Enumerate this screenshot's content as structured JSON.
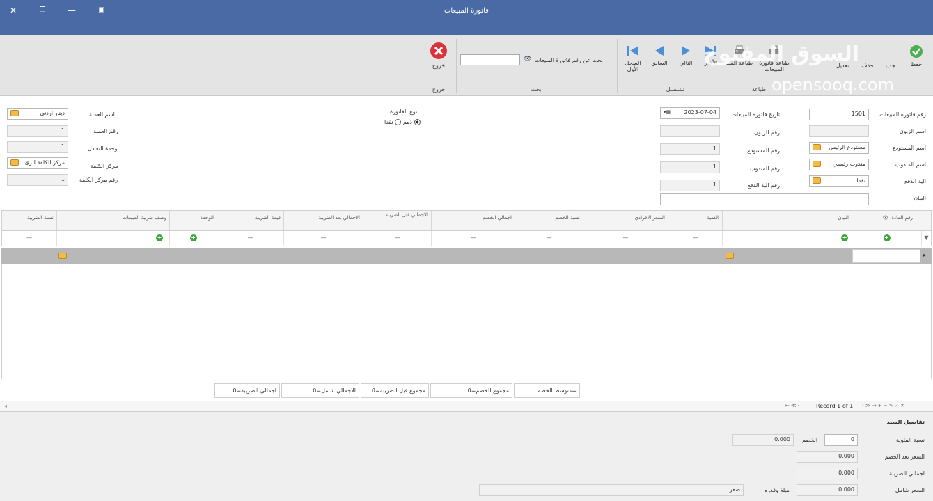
{
  "window": {
    "title": "فاتورة المبيعات",
    "close_label": "✕",
    "restore_label": "❐",
    "minimize_label": "—",
    "pin_label": "▣"
  },
  "ribbon": {
    "save": "حفظ",
    "new": "جديد",
    "delete": "حذف",
    "edit": "تعديل",
    "print_invoice": "طباعة فاتورة المبيعات",
    "print_entry": "طباعة القيد",
    "last": "الأخير",
    "next": "التالي",
    "previous": "السابق",
    "first": "السجل الأول",
    "group_print": "طباعة",
    "group_nav": "تـنــقــل",
    "search_label": "بحث عن رقم فاتورة المبيعات",
    "search_value": "",
    "group_search": "بحث",
    "exit": "خروج",
    "group_exit": "خروج"
  },
  "watermark": {
    "arabic": "السوق المفتوح",
    "latin": "opensooq.com"
  },
  "form": {
    "invoice_no_label": "رقم فاتورة المبيعات",
    "invoice_no": "1501",
    "customer_label": "اسم الزبون",
    "warehouse_label": "اسم المستودع",
    "warehouse_value": "مستودع الرئيس",
    "rep_label": "اسم المندوب",
    "rep_value": "مندوب رئيسي",
    "payment_label": "الية الدفع",
    "payment_value": "نقدا",
    "notes_label": "البيان",
    "date_label": "تاريخ فاتورة المبيعات",
    "date_value": "2023-07-04",
    "customer_no_label": "رقم الزبون",
    "warehouse_no_label": "رقم المستودع",
    "warehouse_no": "1",
    "rep_no_label": "رقم المندوب",
    "rep_no": "1",
    "payment_no_label": "رقم الية الدفع",
    "payment_no": "1",
    "invoice_type_label": "نوع الفاتورة",
    "type_cash": "نقدا",
    "type_credit": "ذمم",
    "currency_label": "اسم العملة",
    "currency_value": "دينار اردني",
    "currency_no_label": "رقم العملة",
    "currency_no": "1",
    "rate_label": "وحدة التعادل",
    "rate_value": "1",
    "cost_center_label": "مركز الكلفة",
    "cost_center_value": "مركز الكلفة الرئ",
    "cost_center_no_label": "رقم مركز الكلفة",
    "cost_center_no": "1"
  },
  "grid": {
    "columns": [
      "رقم المادة",
      "البيان",
      "الكمية",
      "السعر الافرادي",
      "نسبة الخصم",
      "اجمالي الخصم",
      "الاجمالي قبل الضريبة",
      "الاجمالي بعد الضريبة",
      "قيمة الضريبة",
      "الوحدة",
      "وصف ضريبة المبيعات",
      "نسبة الضريبة"
    ],
    "row_values": [
      "",
      "",
      "—",
      "—",
      "—",
      "—",
      "—",
      "—",
      "—",
      "",
      "",
      "—"
    ],
    "summaries": {
      "avg_discount": "متوسط الخصم=",
      "total_discount": "مجموع الخصم=0",
      "total_before_tax": "مجموع قبل الضريبة=0",
      "total_incl": "الاجمالي شامل=0",
      "total_tax": "اجمالي الضريبة=0"
    },
    "record_label": "Record 1 of 1"
  },
  "details": {
    "title": "تفاصيل السند",
    "pct_label": "نسبة المئوية",
    "pct_value": "0",
    "discount_label": "الخصم",
    "discount_value": "0.000",
    "price_after_label": "السعر بعد الخصم",
    "price_after_value": "0.000",
    "tax_total_label": "اجمالي الضريبة",
    "tax_total_value": "0.000",
    "price_incl_label": "السعر شامل",
    "price_incl_value": "0.000",
    "amount_label": "مبلغ وقدره",
    "amount_value": "صفر"
  },
  "colors": {
    "titlebar": "#4a6aa5",
    "ribbon_bg": "#e4e4e4",
    "exit_red": "#d9333b",
    "nav_blue": "#4a8fd8",
    "save_green": "#4caf50"
  }
}
